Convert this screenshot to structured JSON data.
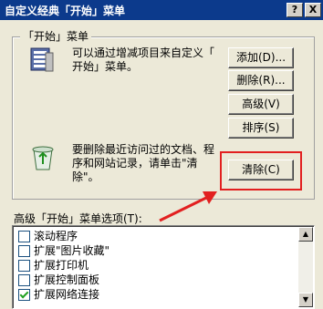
{
  "window": {
    "title": "自定义经典「开始」菜单",
    "help_label": "?",
    "close_label": "X"
  },
  "group": {
    "label": "「开始」菜单",
    "description": [
      "可以通过增减项目来自定义「",
      "开始」菜单。"
    ],
    "clear_description": [
      "要删除最近访问过的文档、程",
      "序和网站记录，请单击\"清",
      "除\"。"
    ]
  },
  "buttons": {
    "add": "添加(D)...",
    "remove": "删除(R)...",
    "advanced": "高级(V)",
    "sort": "排序(S)",
    "clear": "清除(C)"
  },
  "options": {
    "label": "高级「开始」菜单选项(T):",
    "items": [
      {
        "label": "滚动程序",
        "checked": false
      },
      {
        "label": "扩展\"图片收藏\"",
        "checked": false
      },
      {
        "label": "扩展打印机",
        "checked": false
      },
      {
        "label": "扩展控制面板",
        "checked": false
      },
      {
        "label": "扩展网络连接",
        "checked": true
      }
    ]
  },
  "colors": {
    "annotation": "#e22020",
    "titlebar": "#0c3a8c"
  }
}
